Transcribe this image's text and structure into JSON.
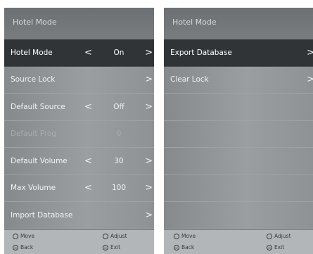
{
  "left_panel": {
    "title": "Hotel Mode",
    "rows": [
      {
        "label": "Hotel Mode",
        "value": "On"
      },
      {
        "label": "Source Lock"
      },
      {
        "label": "Default Source",
        "value": "Off"
      },
      {
        "label": "Default Prog",
        "value": "0"
      },
      {
        "label": "Default Volume",
        "value": "30"
      },
      {
        "label": "Max Volume",
        "value": "100"
      },
      {
        "label": "Import Database"
      }
    ],
    "footer": {
      "move": "Move",
      "adjust": "Adjust",
      "back": "Back",
      "exit": "Exit"
    }
  },
  "right_panel": {
    "title": "Hotel Mode",
    "rows": [
      {
        "label": "Export Database"
      },
      {
        "label": "Clear Lock"
      }
    ],
    "footer": {
      "move": "Move",
      "adjust": "Adjust",
      "back": "Back",
      "exit": "Exit"
    }
  },
  "glyphs": {
    "left": "<",
    "right": ">"
  },
  "colors": {
    "panel_bg": "#777a7c",
    "selected_row": "#313436",
    "footer_bg": "#b3b6b8"
  }
}
